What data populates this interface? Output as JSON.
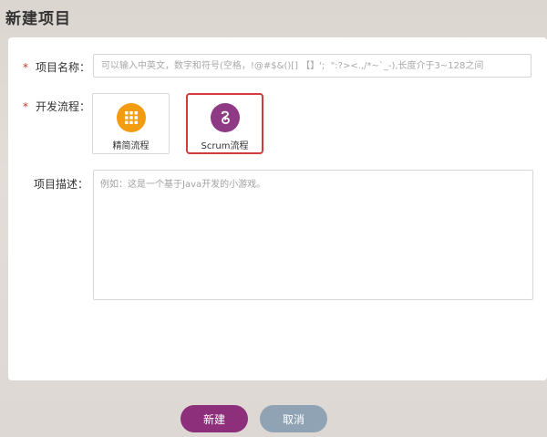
{
  "page": {
    "title": "新建项目"
  },
  "form": {
    "required_mark": "*",
    "name": {
      "label": "项目名称：",
      "value": "",
      "placeholder": "可以输入中英文，数字和符号(空格，!@#$&()[] 【】';  \":?><.,/*~`_-),长度介于3~128之间"
    },
    "flow": {
      "label": "开发流程：",
      "options": [
        {
          "label": "精简流程",
          "icon": "grid-icon",
          "color": "#f39c12",
          "selected": false
        },
        {
          "label": "Scrum流程",
          "icon": "scrum-cycle-icon",
          "color": "#8e3a84",
          "selected": true
        }
      ]
    },
    "description": {
      "label": "项目描述：",
      "value": "",
      "placeholder": "例如：这是一个基于Java开发的小游戏。"
    }
  },
  "actions": {
    "create_label": "新建",
    "cancel_label": "取消"
  },
  "colors": {
    "primary": "#8e2f7c",
    "secondary": "#8fa3b4",
    "required": "#c0392b",
    "selected_border": "#d63b3b"
  }
}
